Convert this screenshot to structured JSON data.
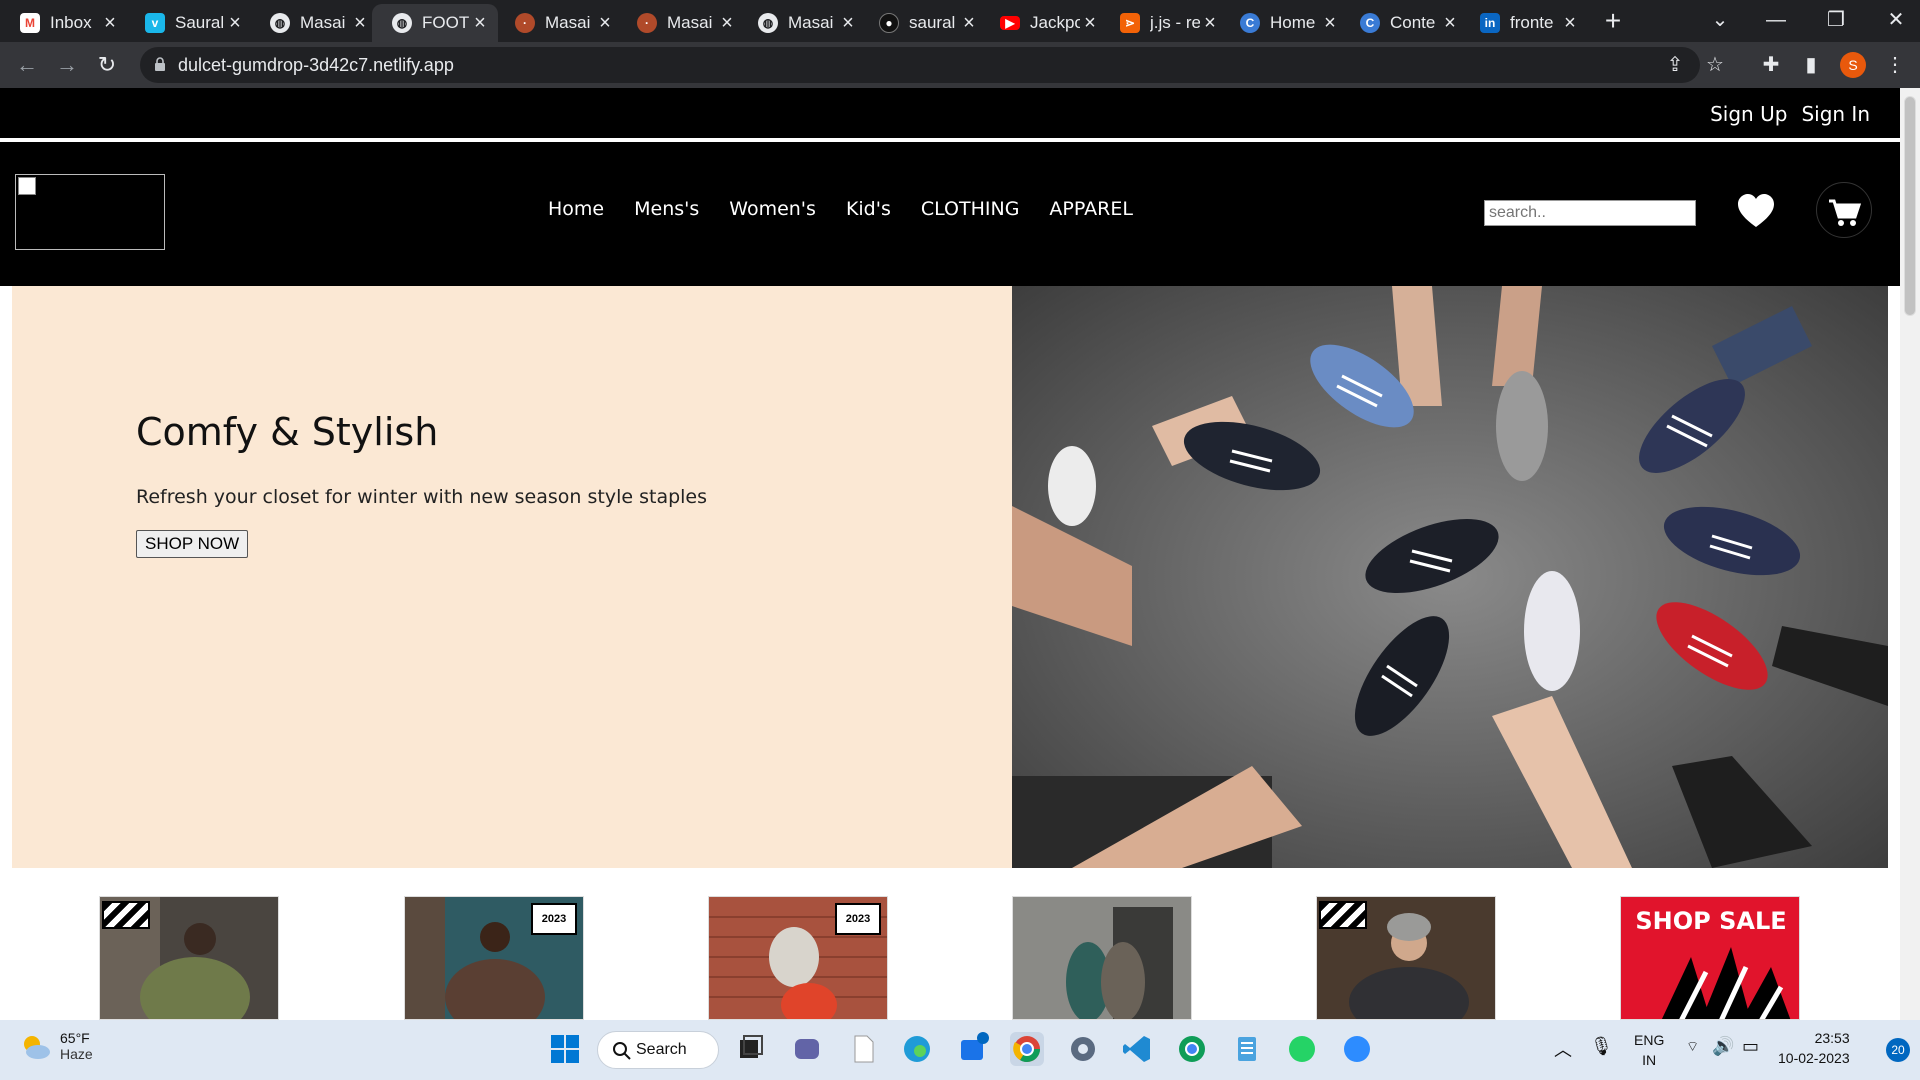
{
  "browser": {
    "tabs": [
      {
        "title": "Inbox",
        "favicon": "gmail-icon",
        "color": "#202124"
      },
      {
        "title": "Saural",
        "favicon": "vimeo-icon",
        "color": "#1ab7ea"
      },
      {
        "title": "Masai",
        "favicon": "globe-icon",
        "color": "#202124"
      },
      {
        "title": "FOOT",
        "favicon": "globe-icon",
        "color": "#35363a",
        "active": true
      },
      {
        "title": "Masai",
        "favicon": "masai-icon",
        "color": "#202124"
      },
      {
        "title": "Masai",
        "favicon": "masai-icon",
        "color": "#202124"
      },
      {
        "title": "Masai",
        "favicon": "globe-icon",
        "color": "#202124"
      },
      {
        "title": "saural",
        "favicon": "github-icon",
        "color": "#202124"
      },
      {
        "title": "Jackpo",
        "favicon": "youtube-icon",
        "color": "#ff0000"
      },
      {
        "title": "j.js - re",
        "favicon": "replit-icon",
        "color": "#f26207"
      },
      {
        "title": "Home",
        "favicon": "canva-icon",
        "color": "#00c4cc"
      },
      {
        "title": "Conte",
        "favicon": "canva-icon",
        "color": "#00c4cc"
      },
      {
        "title": "fronte",
        "favicon": "linkedin-icon",
        "color": "#0a66c2"
      }
    ],
    "url": "dulcet-gumdrop-3d42c7.netlify.app",
    "profile_initial": "S"
  },
  "site": {
    "auth": {
      "signup": "Sign Up",
      "signin": "Sign In"
    },
    "nav": [
      "Home",
      "Mens's",
      "Women's",
      "Kid's",
      "CLOTHING",
      "APPAREL"
    ],
    "search_placeholder": "search..",
    "hero": {
      "title": "Comfy & Stylish",
      "subtitle": "Refresh your closet for winter with new season style staples",
      "cta": "SHOP NOW"
    },
    "thumbs": [
      {
        "badge": "",
        "stripes": true
      },
      {
        "badge": "2023",
        "stripes": false
      },
      {
        "badge": "2023",
        "stripes": false
      },
      {
        "badge": "",
        "stripes": false
      },
      {
        "badge": "",
        "stripes": true
      },
      {
        "sale": "SHOP SALE"
      }
    ]
  },
  "taskbar": {
    "weather_temp": "65°F",
    "weather_cond": "Haze",
    "search_label": "Search",
    "lang_top": "ENG",
    "lang_bottom": "IN",
    "time": "23:53",
    "date": "10-02-2023",
    "notifications": "20"
  }
}
